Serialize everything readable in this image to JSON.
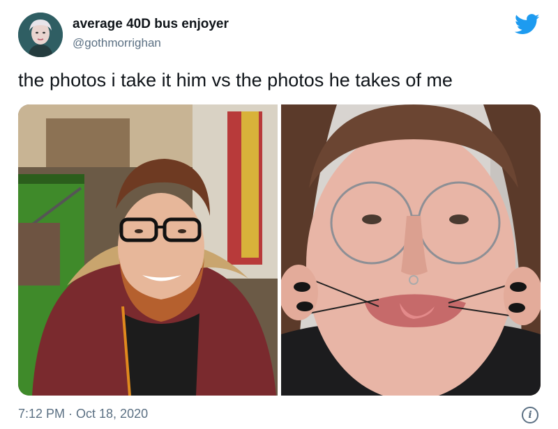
{
  "tweet": {
    "author_name": "average 40D bus enjoyer",
    "author_handle": "@gothmorrighan",
    "text": "the photos i take it him vs the photos he takes of me",
    "timestamp": "7:12 PM · Oct 18, 2020"
  },
  "icons": {
    "brand": "twitter-bird-icon",
    "info": "info-icon"
  },
  "colors": {
    "twitter_blue": "#1d9bf0",
    "secondary_text": "#5b7083",
    "primary_text": "#0f1419"
  }
}
